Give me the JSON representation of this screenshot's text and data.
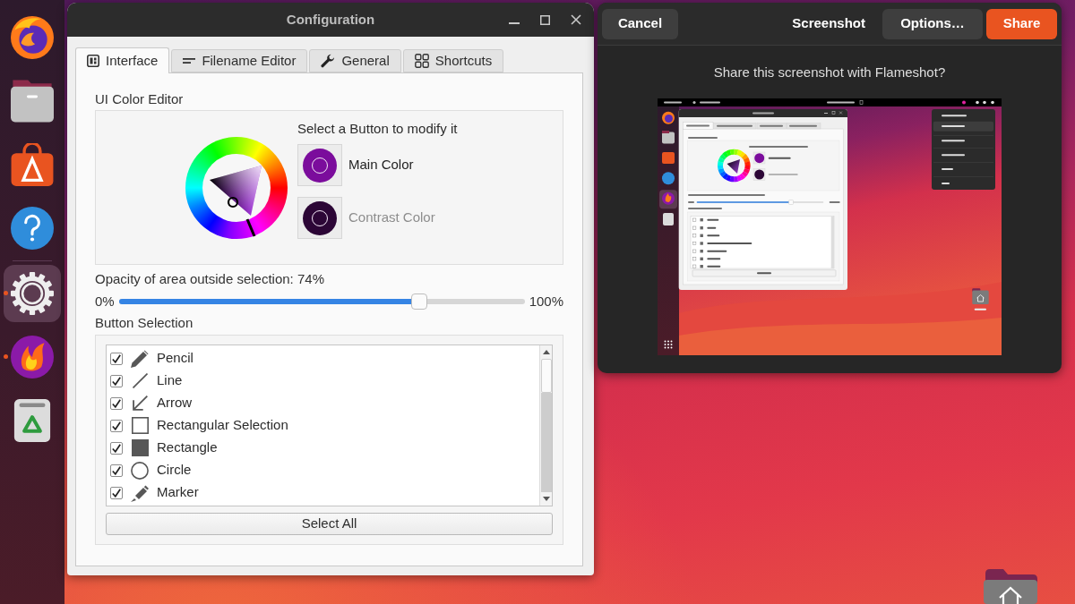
{
  "dock": {
    "items": [
      {
        "kind": "browser",
        "selected": false,
        "running": false
      },
      {
        "kind": "files",
        "selected": false,
        "running": false
      },
      {
        "kind": "store",
        "selected": false,
        "running": false
      },
      {
        "kind": "help",
        "selected": false,
        "running": false
      },
      {
        "kind": "settings",
        "selected": true,
        "running": true
      },
      {
        "kind": "flameshot",
        "selected": false,
        "running": true
      },
      {
        "kind": "trash",
        "selected": false,
        "running": false
      }
    ]
  },
  "config_window": {
    "title": "Configuration",
    "tabs": [
      {
        "kind": "interface",
        "label": "Interface",
        "selected": true
      },
      {
        "kind": "filename",
        "label": "Filename Editor",
        "selected": false
      },
      {
        "kind": "general",
        "label": "General",
        "selected": false
      },
      {
        "kind": "shortcuts",
        "label": "Shortcuts",
        "selected": false
      }
    ],
    "color_editor": {
      "title": "UI Color Editor",
      "prompt": "Select a Button to modify it",
      "buttons": [
        {
          "label": "Main Color",
          "color": "#7b0c9c",
          "selected": true
        },
        {
          "label": "Contrast Color",
          "color": "#2c0636",
          "selected": false
        }
      ]
    },
    "opacity": {
      "label": "Opacity of area outside selection: 74%",
      "min_label": "0%",
      "max_label": "100%",
      "level": 0.74
    },
    "button_selection": {
      "title": "Button Selection",
      "items": [
        {
          "kind": "pencil",
          "label": "Pencil",
          "checked": true
        },
        {
          "kind": "line",
          "label": "Line",
          "checked": true
        },
        {
          "kind": "arrow",
          "label": "Arrow",
          "checked": true
        },
        {
          "kind": "selection",
          "label": "Rectangular Selection",
          "checked": true
        },
        {
          "kind": "rectangle",
          "label": "Rectangle",
          "checked": true
        },
        {
          "kind": "circle",
          "label": "Circle",
          "checked": true
        },
        {
          "kind": "marker",
          "label": "Marker",
          "checked": true
        }
      ],
      "select_all": "Select All"
    }
  },
  "share_dialog": {
    "cancel": "Cancel",
    "title": "Screenshot",
    "options": "Options…",
    "share": "Share",
    "message": "Share this screenshot with Flameshot?"
  }
}
